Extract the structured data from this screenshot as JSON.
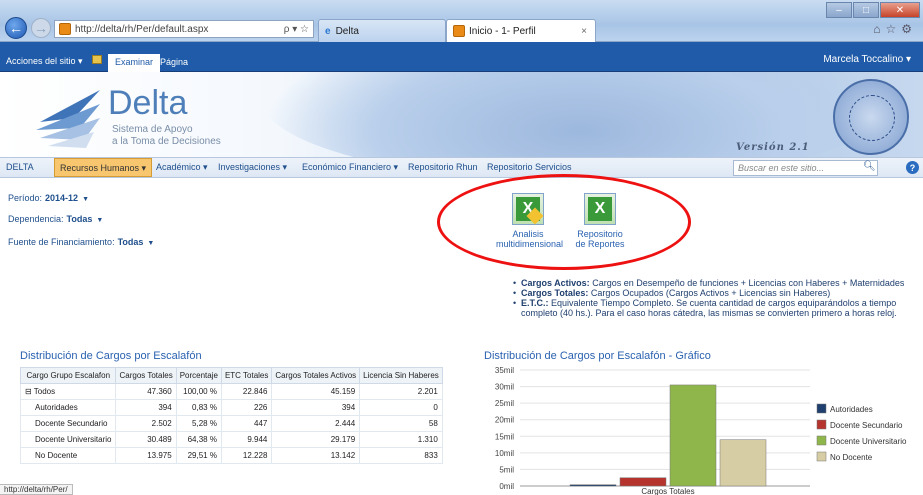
{
  "browser": {
    "url": "http://delta/rh/Per/default.aspx",
    "url_controls": "ρ ▾ ☆",
    "tab1_label": "Delta",
    "tab2_label": "Inicio - 1- Perfil",
    "back_glyph": "←",
    "forward_glyph": "→",
    "close_glyph": "×",
    "status_url": "http://delta/rh/Per/"
  },
  "ribbon": {
    "actions_label": "Acciones del sitio ▾",
    "tab_examinar": "Examinar",
    "tab_pagina": "Página",
    "user": "Marcela Toccalino ▾"
  },
  "banner": {
    "title": "Delta",
    "subtitle_line1": "Sistema de Apoyo",
    "subtitle_line2": "a la Toma de Decisiones",
    "version": "Versión 2.1"
  },
  "topnav": {
    "items": [
      "DELTA",
      "Recursos Humanos ▾",
      "Académico ▾",
      "Investigaciones ▾",
      "Económico Financiero ▾",
      "Repositorio Rhun",
      "Repositorio Servicios"
    ],
    "search_placeholder": "Buscar en este sitio...",
    "help": "?"
  },
  "filters": {
    "periodo_label": "Período:",
    "periodo_value": "2014-12",
    "dependencia_label": "Dependencia:",
    "dependencia_value": "Todas",
    "fuente_label": "Fuente de Financiamiento:",
    "fuente_value": "Todas",
    "caret": "▼"
  },
  "reports": {
    "r1_line1": "Analisis",
    "r1_line2": "multidimensional",
    "r2_line1": "Repositorio",
    "r2_line2": "de Reportes",
    "icon_letter": "X"
  },
  "definitions": {
    "d1_term": "Cargos Activos:",
    "d1_text": " Cargos en Desempeño de funciones + Licencias con Haberes + Maternidades",
    "d2_term": "Cargos Totales:",
    "d2_text": " Cargos Ocupados (Cargos Activos + Licencias sin Haberes)",
    "d3_term": "E.T.C.:",
    "d3_text": " Equivalente Tiempo Completo. Se cuenta cantidad de cargos equiparándolos a tiempo completo (40 hs.). Para el caso horas cátedra, las mismas se convierten primero a horas reloj."
  },
  "table": {
    "title": "Distribución de Cargos por Escalafón",
    "headers": [
      "Cargo Grupo Escalafon",
      "Cargos Totales",
      "Porcentaje",
      "ETC Totales",
      "Cargos Totales Activos",
      "Licencia Sin Haberes"
    ],
    "rows": [
      [
        "⊟ Todos",
        "47.360",
        "100,00 %",
        "22.846",
        "45.159",
        "2.201"
      ],
      [
        "Autoridades",
        "394",
        "0,83 %",
        "226",
        "394",
        "0"
      ],
      [
        "Docente Secundario",
        "2.502",
        "5,28 %",
        "447",
        "2.444",
        "58"
      ],
      [
        "Docente Universitario",
        "30.489",
        "64,38 %",
        "9.944",
        "29.179",
        "1.310"
      ],
      [
        "No Docente",
        "13.975",
        "29,51 %",
        "12.228",
        "13.142",
        "833"
      ]
    ]
  },
  "chart_title": "Distribución de Cargos por Escalafón - Gráfico",
  "chart_data": {
    "type": "bar",
    "categories": [
      "Cargos Totales"
    ],
    "series": [
      {
        "name": "Autoridades",
        "values": [
          394
        ],
        "color": "#1f3f6e"
      },
      {
        "name": "Docente Secundario",
        "values": [
          2502
        ],
        "color": "#b5342e"
      },
      {
        "name": "Docente Universitario",
        "values": [
          30489
        ],
        "color": "#8fb64a"
      },
      {
        "name": "No Docente",
        "values": [
          13975
        ],
        "color": "#d6cda4"
      }
    ],
    "ylim": [
      0,
      35000
    ],
    "yticks": [
      "0mil",
      "5mil",
      "10mil",
      "15mil",
      "20mil",
      "25mil",
      "30mil",
      "35mil"
    ],
    "xlabel": "Cargos Totales",
    "legend_position": "right"
  }
}
